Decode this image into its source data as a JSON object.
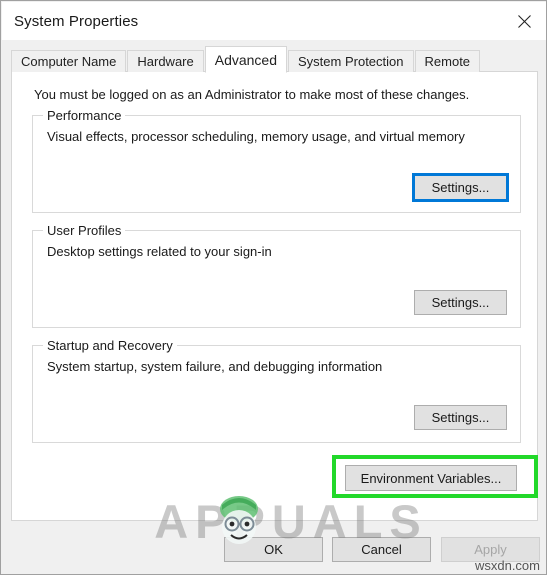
{
  "window": {
    "title": "System Properties",
    "close_icon": "close-icon"
  },
  "tabs": [
    {
      "label": "Computer Name",
      "selected": false
    },
    {
      "label": "Hardware",
      "selected": false
    },
    {
      "label": "Advanced",
      "selected": true
    },
    {
      "label": "System Protection",
      "selected": false
    },
    {
      "label": "Remote",
      "selected": false
    }
  ],
  "content": {
    "intro": "You must be logged on as an Administrator to make most of these changes.",
    "groups": [
      {
        "legend": "Performance",
        "description": "Visual effects, processor scheduling, memory usage, and virtual memory",
        "button_label": "Settings...",
        "focused": true
      },
      {
        "legend": "User Profiles",
        "description": "Desktop settings related to your sign-in",
        "button_label": "Settings...",
        "focused": false
      },
      {
        "legend": "Startup and Recovery",
        "description": "System startup, system failure, and debugging information",
        "button_label": "Settings...",
        "focused": false
      }
    ],
    "environment_variables_label": "Environment Variables..."
  },
  "footer": {
    "ok_label": "OK",
    "cancel_label": "Cancel",
    "apply_label": "Apply",
    "apply_disabled": true
  },
  "annotations": {
    "highlight_color": "#22d82a"
  },
  "watermarks": {
    "brand": "APPUALS",
    "source": "wsxdn.com"
  },
  "colors": {
    "focus_blue": "#0078d7",
    "dialog_bg": "#f0f0f0",
    "panel_bg": "#ffffff",
    "button_bg": "#e1e1e1"
  }
}
